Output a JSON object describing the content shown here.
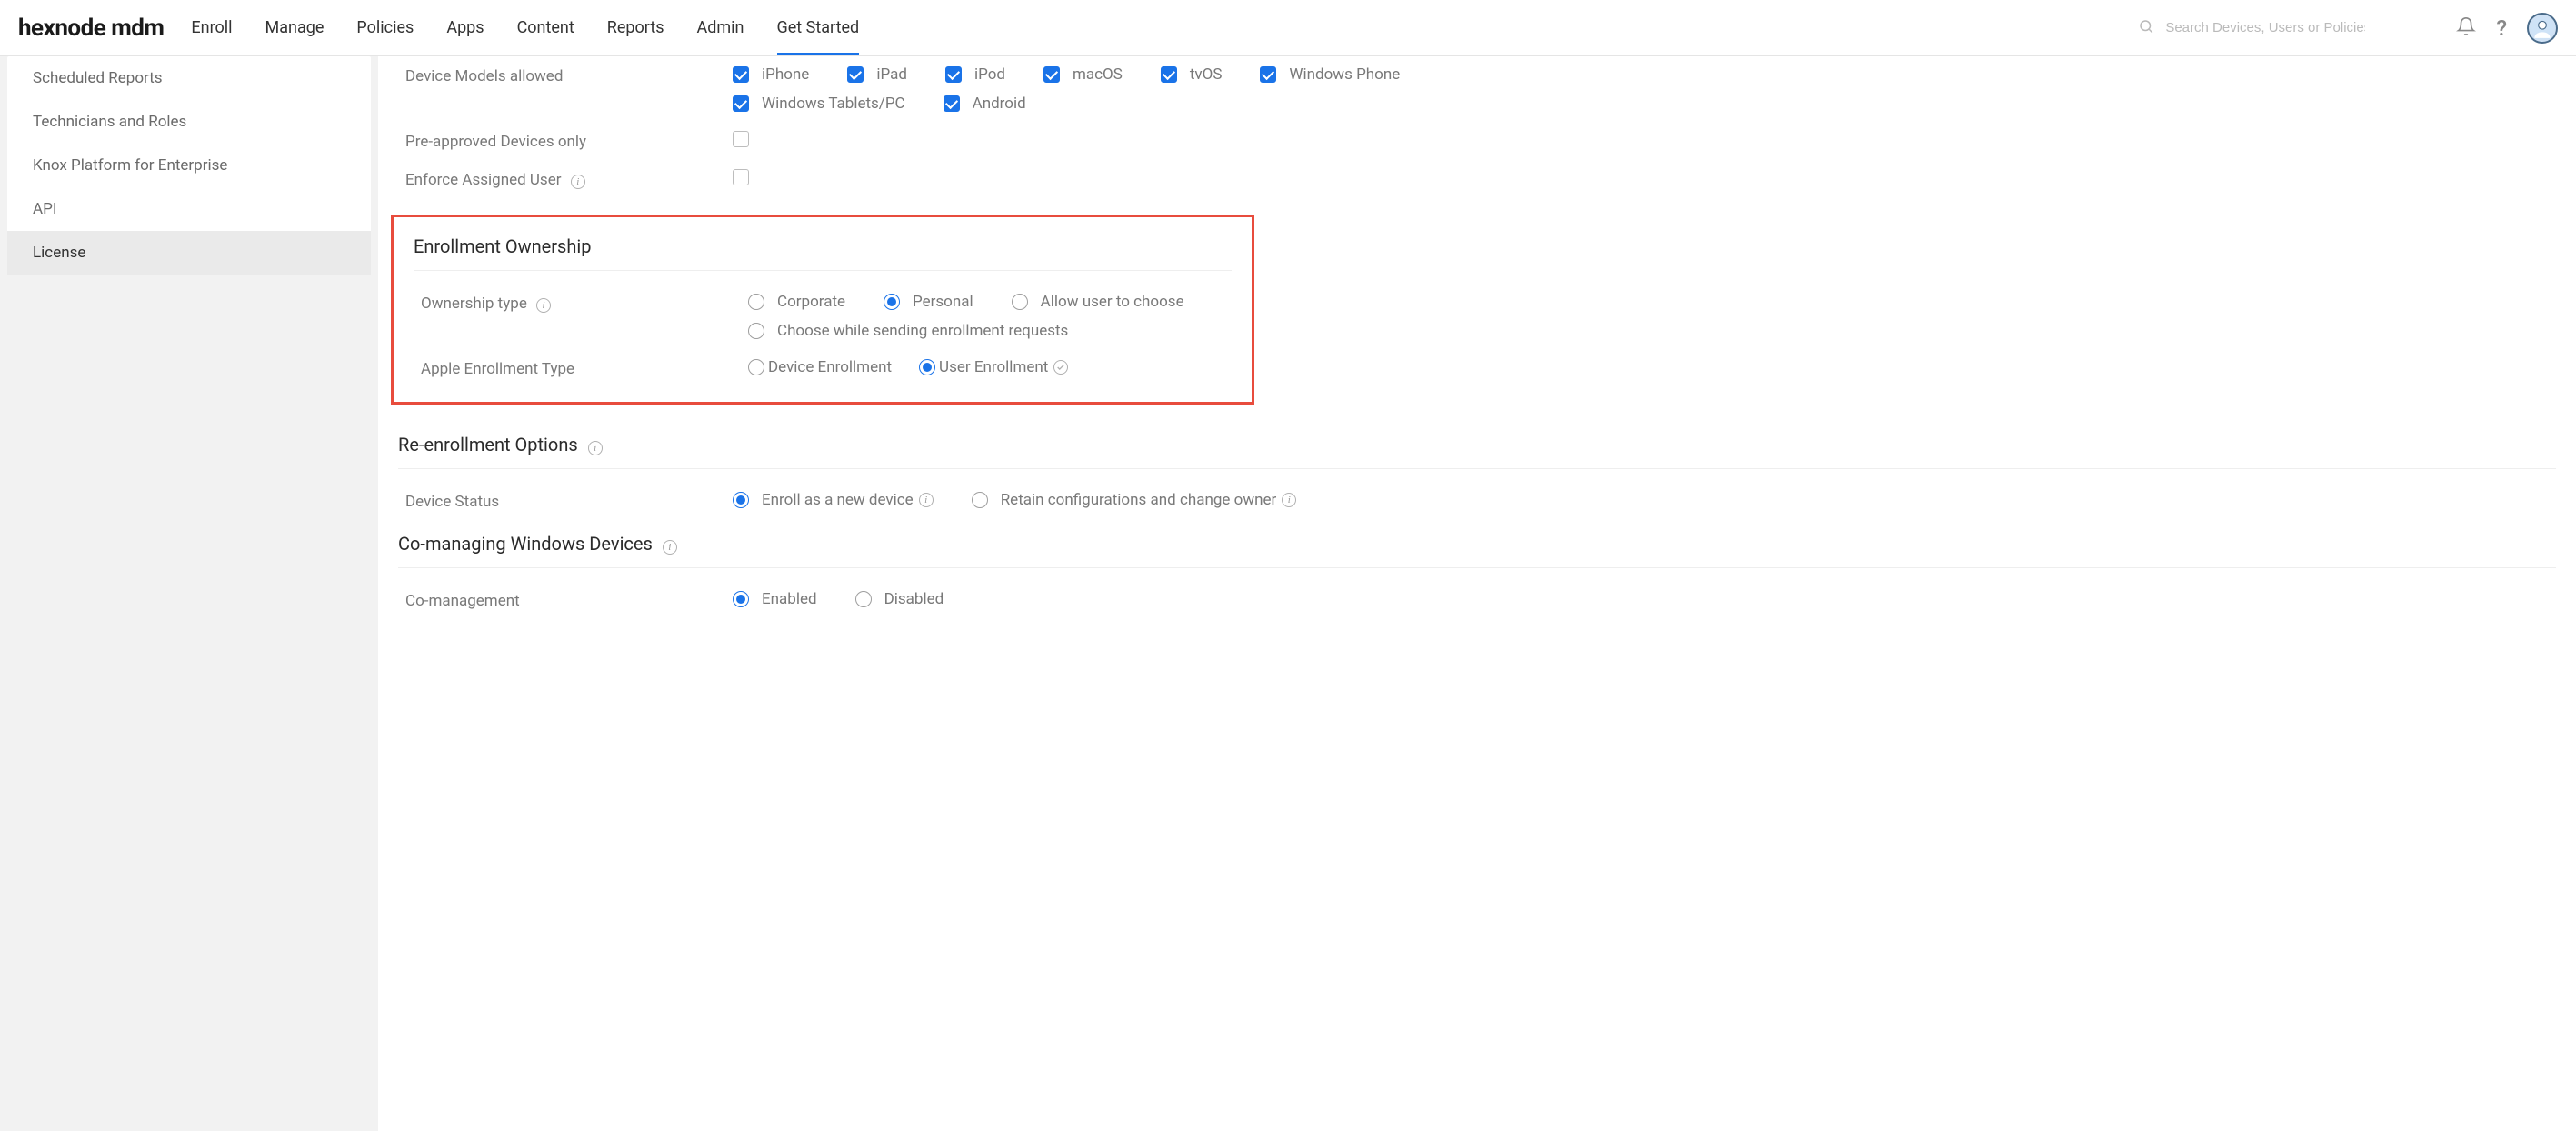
{
  "brand": "hexnode mdm",
  "nav": {
    "items": [
      "Enroll",
      "Manage",
      "Policies",
      "Apps",
      "Content",
      "Reports",
      "Admin",
      "Get Started"
    ],
    "active_index": 7
  },
  "search": {
    "placeholder": "Search Devices, Users or Policies"
  },
  "sidebar": {
    "items": [
      "Scheduled Reports",
      "Technicians and Roles",
      "Knox Platform for Enterprise",
      "API",
      "License"
    ],
    "selected_index": 4
  },
  "settings": {
    "device_models": {
      "label": "Device Models allowed",
      "options": [
        {
          "label": "iPhone",
          "checked": true
        },
        {
          "label": "iPad",
          "checked": true
        },
        {
          "label": "iPod",
          "checked": true
        },
        {
          "label": "macOS",
          "checked": true
        },
        {
          "label": "tvOS",
          "checked": true
        },
        {
          "label": "Windows Phone",
          "checked": true
        },
        {
          "label": "Windows Tablets/PC",
          "checked": true
        },
        {
          "label": "Android",
          "checked": true
        }
      ]
    },
    "pre_approved": {
      "label": "Pre-approved Devices only",
      "checked": false
    },
    "enforce_user": {
      "label": "Enforce Assigned User",
      "checked": false
    },
    "ownership_section": {
      "title": "Enrollment Ownership"
    },
    "ownership_type": {
      "label": "Ownership type",
      "options": [
        {
          "label": "Corporate",
          "selected": false
        },
        {
          "label": "Personal",
          "selected": true
        },
        {
          "label": "Allow user to choose",
          "selected": false
        },
        {
          "label": "Choose while sending enrollment requests",
          "selected": false
        }
      ]
    },
    "apple_enroll": {
      "label": "Apple Enrollment Type",
      "options": [
        {
          "label": "Device Enrollment",
          "selected": false
        },
        {
          "label": "User Enrollment",
          "selected": true
        }
      ]
    },
    "reenroll_section": {
      "title": "Re-enrollment Options"
    },
    "device_status": {
      "label": "Device Status",
      "options": [
        {
          "label": "Enroll as a new device",
          "selected": true
        },
        {
          "label": "Retain configurations and change owner",
          "selected": false
        }
      ]
    },
    "comanage_section": {
      "title": "Co-managing Windows Devices"
    },
    "comanagement": {
      "label": "Co-management",
      "options": [
        {
          "label": "Enabled",
          "selected": true
        },
        {
          "label": "Disabled",
          "selected": false
        }
      ]
    }
  }
}
